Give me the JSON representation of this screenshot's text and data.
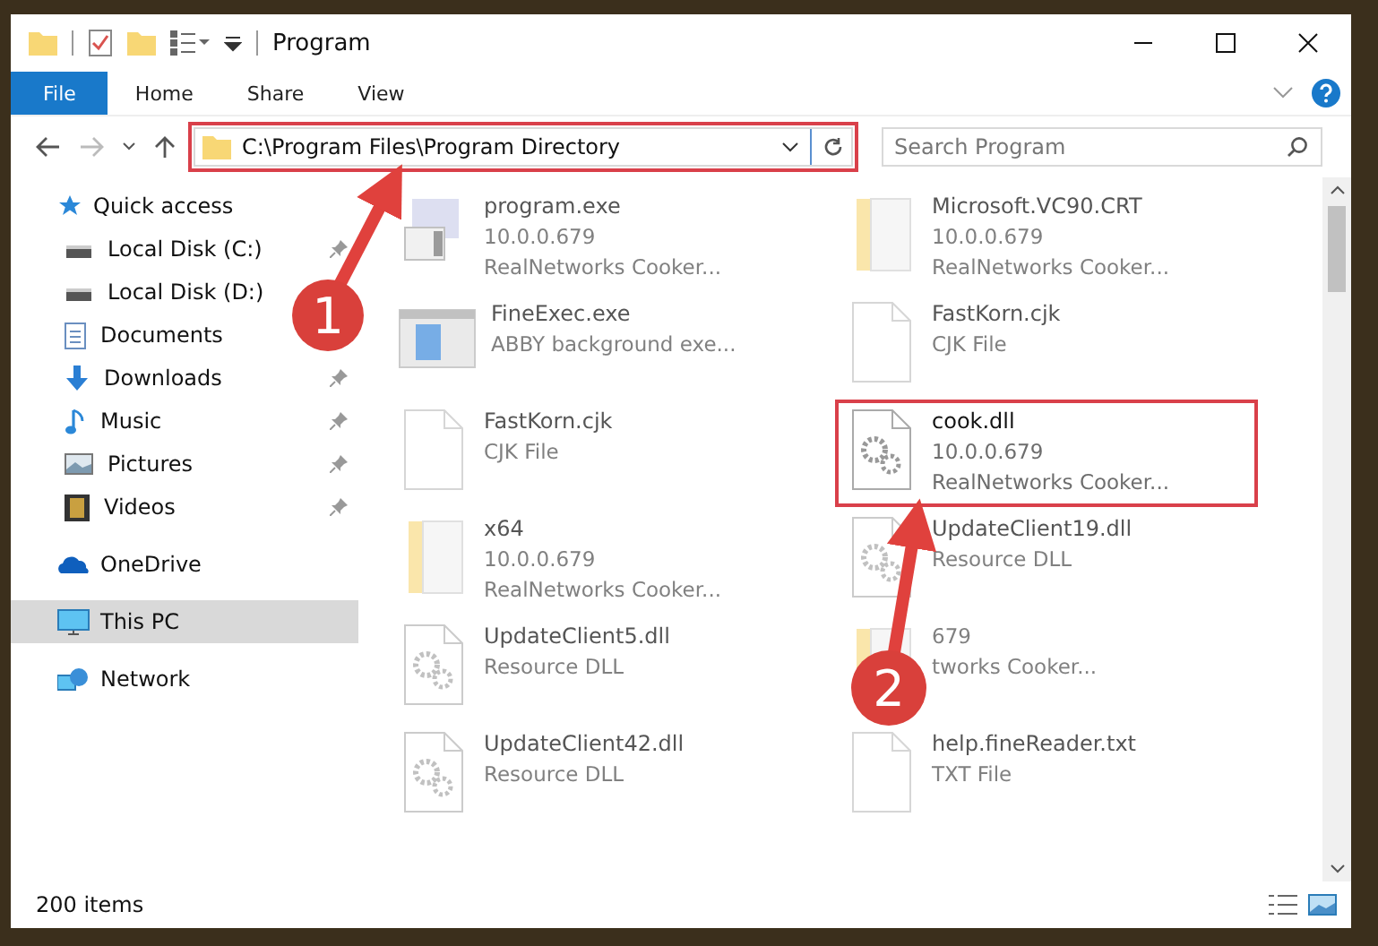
{
  "window": {
    "title": "Program"
  },
  "ribbon": {
    "tabs": [
      {
        "label": "File",
        "selected": true
      },
      {
        "label": "Home",
        "selected": false
      },
      {
        "label": "Share",
        "selected": false
      },
      {
        "label": "View",
        "selected": false
      }
    ]
  },
  "address": {
    "path": "C:\\Program Files\\Program Directory",
    "highlighted": true
  },
  "search": {
    "placeholder": "Search Program"
  },
  "sidebar": {
    "items": [
      {
        "label": "Quick access",
        "kind": "star",
        "selected": false,
        "children": [
          {
            "label": "Local Disk (C:)",
            "kind": "drive",
            "pinned": true
          },
          {
            "label": "Local Disk (D:)",
            "kind": "drive",
            "pinned": false
          },
          {
            "label": "Documents",
            "kind": "doc",
            "pinned": false
          },
          {
            "label": "Downloads",
            "kind": "download",
            "pinned": true
          },
          {
            "label": "Music",
            "kind": "music",
            "pinned": true
          },
          {
            "label": "Pictures",
            "kind": "pictures",
            "pinned": true
          },
          {
            "label": "Videos",
            "kind": "video",
            "pinned": true
          }
        ]
      },
      {
        "label": "OneDrive",
        "kind": "cloud",
        "selected": false
      },
      {
        "label": "This PC",
        "kind": "pc",
        "selected": true
      },
      {
        "label": "Network",
        "kind": "network",
        "selected": false
      }
    ]
  },
  "files": [
    {
      "kind": "exe",
      "name": "program.exe",
      "lines": [
        "10.0.0.679",
        "RealNetworks Cooker..."
      ],
      "highlighted": false
    },
    {
      "kind": "folder",
      "name": "Microsoft.VC90.CRT",
      "lines": [
        "10.0.0.679",
        "RealNetworks Cooker..."
      ],
      "highlighted": false
    },
    {
      "kind": "app",
      "name": "FineExec.exe",
      "lines": [
        "ABBY background exe..."
      ],
      "highlighted": false
    },
    {
      "kind": "file",
      "name": "FastKorn.cjk",
      "lines": [
        "CJK File"
      ],
      "highlighted": false
    },
    {
      "kind": "file",
      "name": "FastKorn.cjk",
      "lines": [
        "CJK File"
      ],
      "highlighted": false
    },
    {
      "kind": "dll",
      "name": "cook.dll",
      "lines": [
        "10.0.0.679",
        "RealNetworks Cooker..."
      ],
      "highlighted": true
    },
    {
      "kind": "folder",
      "name": "x64",
      "lines": [
        "10.0.0.679",
        "RealNetworks Cooker..."
      ],
      "highlighted": false
    },
    {
      "kind": "dll",
      "name": "UpdateClient19.dll",
      "lines": [
        "Resource DLL"
      ],
      "highlighted": false
    },
    {
      "kind": "dll",
      "name": "UpdateClient5.dll",
      "lines": [
        "Resource DLL"
      ],
      "highlighted": false
    },
    {
      "kind": "folder",
      "lines": [
        "679",
        "tworks Cooker..."
      ],
      "highlighted": false
    },
    {
      "kind": "dll",
      "name": "UpdateClient42.dll",
      "lines": [
        "Resource DLL"
      ],
      "highlighted": false
    },
    {
      "kind": "file",
      "name": "help.fineReader.txt",
      "lines": [
        "TXT File"
      ],
      "highlighted": false
    }
  ],
  "status_bar": {
    "count": "200 items"
  },
  "annotations": [
    {
      "label": "1"
    },
    {
      "label": "2"
    }
  ]
}
